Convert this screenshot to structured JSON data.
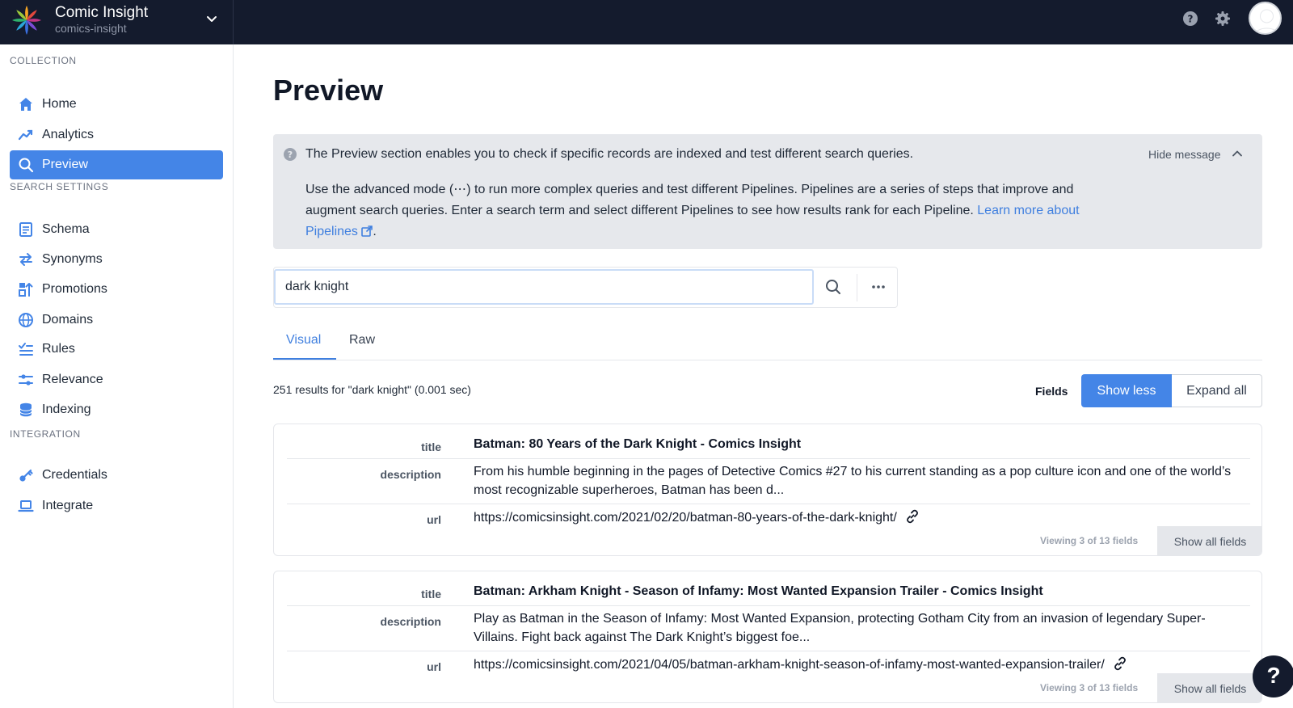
{
  "org": {
    "name": "Comic Insight",
    "slug": "comics-insight"
  },
  "sidebar": {
    "sections": [
      {
        "title": "Collection"
      },
      {
        "title": "Search Settings"
      },
      {
        "title": "Integration"
      }
    ],
    "items": [
      {
        "label": "Home",
        "icon": "home-icon"
      },
      {
        "label": "Analytics",
        "icon": "analytics-icon"
      },
      {
        "label": "Preview",
        "icon": "search-icon"
      },
      {
        "label": "Schema",
        "icon": "schema-icon"
      },
      {
        "label": "Synonyms",
        "icon": "arrows-swap-icon"
      },
      {
        "label": "Promotions",
        "icon": "promotions-icon"
      },
      {
        "label": "Domains",
        "icon": "globe-icon"
      },
      {
        "label": "Rules",
        "icon": "rules-icon"
      },
      {
        "label": "Relevance",
        "icon": "sliders-icon"
      },
      {
        "label": "Indexing",
        "icon": "database-icon"
      },
      {
        "label": "Credentials",
        "icon": "key-icon"
      },
      {
        "label": "Integrate",
        "icon": "laptop-icon"
      }
    ],
    "active": "Preview"
  },
  "page": {
    "title": "Preview"
  },
  "callout": {
    "line1": "The Preview section enables you to check if specific records are indexed and test different search queries.",
    "line2": "Use the advanced mode (⋯) to run more complex queries and test different Pipelines. Pipelines are a series of steps that improve and augment search queries. Enter a search term and select different Pipelines to see how results rank for each Pipeline. ",
    "link": "Learn more about Pipelines",
    "period": ".",
    "hide": "Hide message"
  },
  "search": {
    "value": "dark knight"
  },
  "tabs": [
    {
      "label": "Visual"
    },
    {
      "label": "Raw"
    }
  ],
  "results": {
    "summary": "251 results for \"dark knight\" (0.001 sec)",
    "fields_label": "Fields",
    "show_less": "Show less",
    "expand_all": "Expand all",
    "items": [
      {
        "title": "Batman: 80 Years of the Dark Knight - Comics Insight",
        "description": "From his humble beginning in the pages of Detective Comics #27 to his current standing as a pop culture icon and one of the world’s most recognizable superheroes, Batman has been d...",
        "url": "https://comicsinsight.com/2021/02/20/batman-80-years-of-the-dark-knight/",
        "viewing": "Viewing 3 of 13 fields",
        "show_all": "Show all fields"
      },
      {
        "title": "Batman: Arkham Knight - Season of Infamy: Most Wanted Expansion Trailer - Comics Insight",
        "description": "Play as Batman in the Season of Infamy: Most Wanted Expansion, protecting Gotham City from an invasion of legendary Super-Villains. Fight back against The Dark Knight’s biggest foe...",
        "url": "https://comicsinsight.com/2021/04/05/batman-arkham-knight-season-of-infamy-most-wanted-expansion-trailer/",
        "viewing": "Viewing 3 of 13 fields",
        "show_all": "Show all fields"
      }
    ]
  },
  "field_keys": {
    "title": "title",
    "description": "description",
    "url": "url"
  },
  "fab": {
    "label": "?"
  },
  "colors": {
    "topbar": "#141b2d",
    "accent": "#4485e7",
    "link": "#3f7fdf",
    "callout_bg": "#e6e8ec"
  }
}
